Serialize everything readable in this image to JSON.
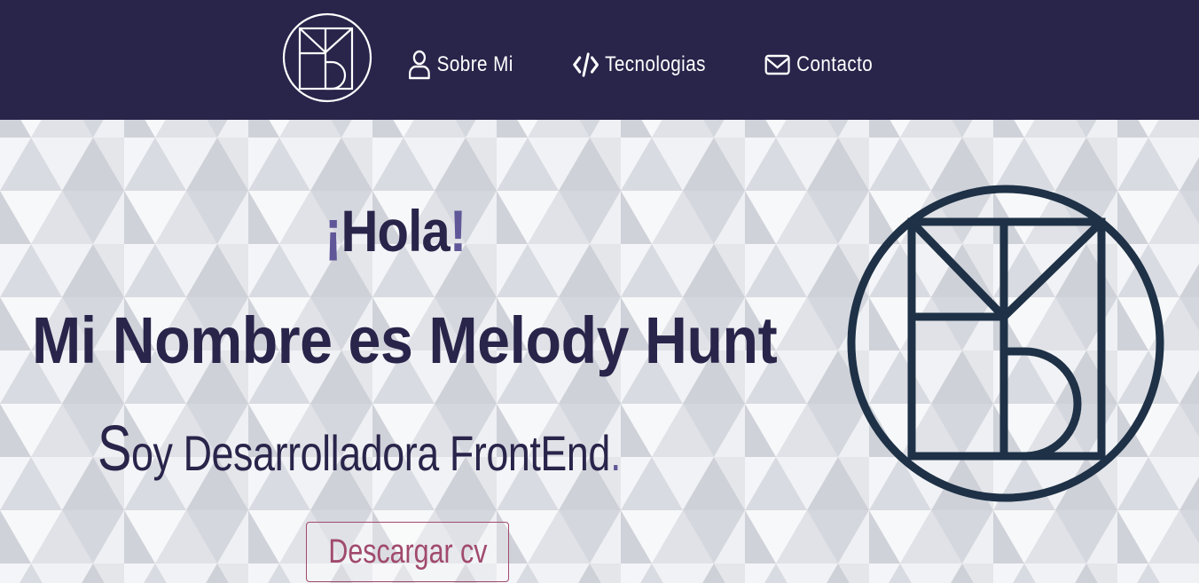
{
  "nav": {
    "logo_icon": "monogram-logo",
    "links": [
      {
        "label": "Sobre Mi",
        "icon": "user-icon"
      },
      {
        "label": "Tecnologias",
        "icon": "code-icon"
      },
      {
        "label": "Contacto",
        "icon": "envelope-icon"
      }
    ]
  },
  "hero": {
    "greeting_open": "¡",
    "greeting_word": "Hola",
    "greeting_close": "!",
    "name_heading": "Mi Nombre es Melody Hunt",
    "subtitle_cap": "S",
    "subtitle_rest": "oy Desarrolladora FrontEnd",
    "subtitle_dot": ".",
    "button_label": "Descargar cv",
    "logo_icon": "monogram-logo"
  },
  "colors": {
    "nav_bg": "#29244a",
    "text_dark": "#29244a",
    "accent_purple": "#5f5798",
    "button_accent": "#a14a6e",
    "logo_stroke": "#1e3146"
  }
}
